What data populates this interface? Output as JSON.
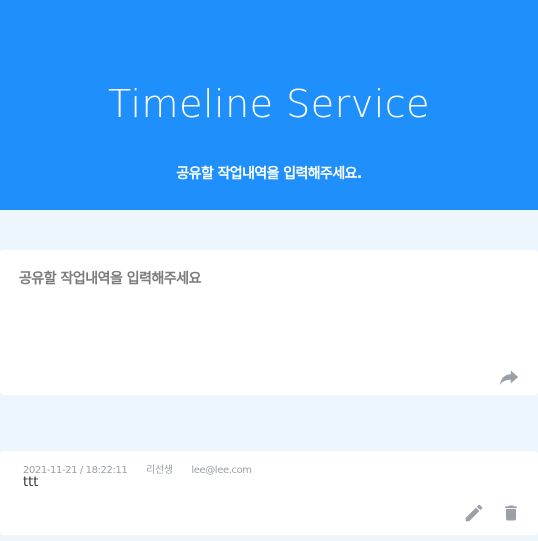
{
  "hero": {
    "title": "Timeline Service",
    "subtitle": "공유할 작업내역을 입력해주세요."
  },
  "composer": {
    "placeholder": "공유할 작업내역을 입력해주세요",
    "send_icon": "share-arrow-icon"
  },
  "posts": [
    {
      "datetime": "2021-11-21 / 18:22:11",
      "author": "리선생",
      "email": "lee@lee.com",
      "content": "ttt",
      "edit_icon": "pencil-icon",
      "delete_icon": "trash-icon"
    }
  ],
  "colors": {
    "hero_bg": "#1e8ffb",
    "page_bg": "#eef6fd",
    "icon_gray": "#9aa0a6"
  }
}
